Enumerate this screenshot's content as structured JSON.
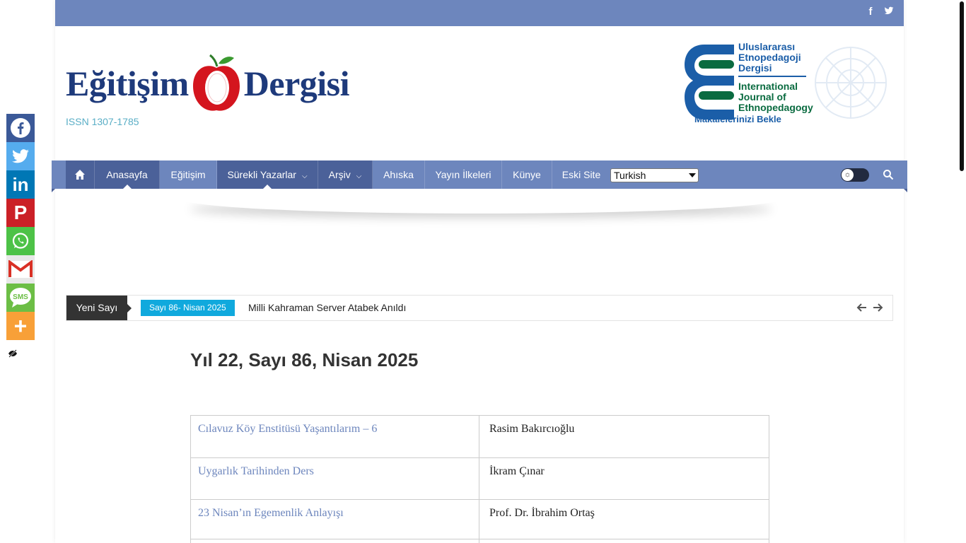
{
  "site": {
    "logo_part1": "Eğitişim",
    "logo_part2": "Dergisi",
    "issn": "ISSN 1307-1785"
  },
  "banner": {
    "line1": "Uluslararası",
    "line2": "Etnopedagoji",
    "line3": "Dergisi",
    "line4": "International",
    "line5": "Journal of",
    "line6": "Ethnopedagogy",
    "line7": "Makalelerinizi Bekle"
  },
  "social_top": [
    "facebook-icon",
    "twitter-icon"
  ],
  "nav": {
    "items": [
      {
        "label": "Anasayfa"
      },
      {
        "label": "Eğitişim"
      },
      {
        "label": "Sürekli Yazarlar"
      },
      {
        "label": "Arşiv"
      },
      {
        "label": "Ahıska"
      },
      {
        "label": "Yayın İlkeleri"
      },
      {
        "label": "Künye"
      },
      {
        "label": "Eski Site"
      }
    ],
    "language": "Turkish"
  },
  "ticker": {
    "label": "Yeni Sayı",
    "badge": "Sayı 86- Nisan 2025",
    "headline": "Milli Kahraman Server Atabek Anıldı"
  },
  "issue": {
    "title": "Yıl 22, Sayı 86, Nisan 2025",
    "articles": [
      {
        "title": "Cılavuz Köy Enstitüsü Yaşantılarım – 6",
        "author": "Rasim Bakırcıoğlu"
      },
      {
        "title": "Uygarlık Tarihinden Ders",
        "author": "İkram Çınar"
      },
      {
        "title": "23 Nisan’ın Egemenlik Anlayışı",
        "author": "Prof. Dr. İbrahim Ortaş"
      }
    ]
  },
  "share_buttons": [
    {
      "name": "facebook",
      "color": "#3b5998"
    },
    {
      "name": "twitter",
      "color": "#55acee"
    },
    {
      "name": "linkedin",
      "color": "#0077b5"
    },
    {
      "name": "pinterest",
      "color": "#cb2027"
    },
    {
      "name": "whatsapp",
      "color": "#4dc247"
    },
    {
      "name": "gmail",
      "color": "#e8e8e8"
    },
    {
      "name": "sms",
      "color": "#6cbe45"
    },
    {
      "name": "more",
      "color": "#f8a038"
    }
  ],
  "colors": {
    "brand_blue": "#6d86bd",
    "brand_dark": "#4b6199",
    "accent_cyan": "#10a9dd"
  }
}
